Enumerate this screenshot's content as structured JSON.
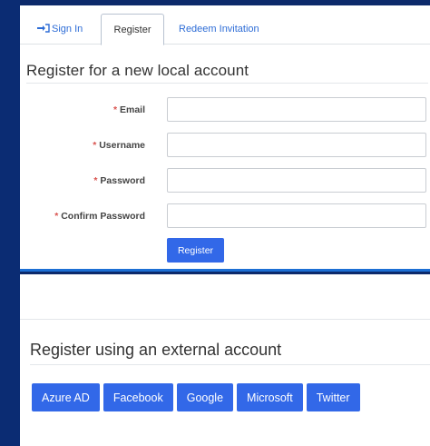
{
  "tabs": {
    "signin_label": "Sign In",
    "register_label": "Register",
    "redeem_label": "Redeem Invitation"
  },
  "local": {
    "heading": "Register for a new local account",
    "fields": [
      {
        "label": "Email",
        "required_mark": "*",
        "value": ""
      },
      {
        "label": "Username",
        "required_mark": "*",
        "value": ""
      },
      {
        "label": "Password",
        "required_mark": "*",
        "value": ""
      },
      {
        "label": "Confirm Password",
        "required_mark": "*",
        "value": ""
      }
    ],
    "submit_label": "Register"
  },
  "external": {
    "heading": "Register using an external account",
    "providers": [
      "Azure AD",
      "Facebook",
      "Google",
      "Microsoft",
      "Twitter"
    ]
  },
  "colors": {
    "primary": "#3268e8",
    "link": "#2d6cd6",
    "required": "#d9534f",
    "background": "#0c2a6b"
  }
}
